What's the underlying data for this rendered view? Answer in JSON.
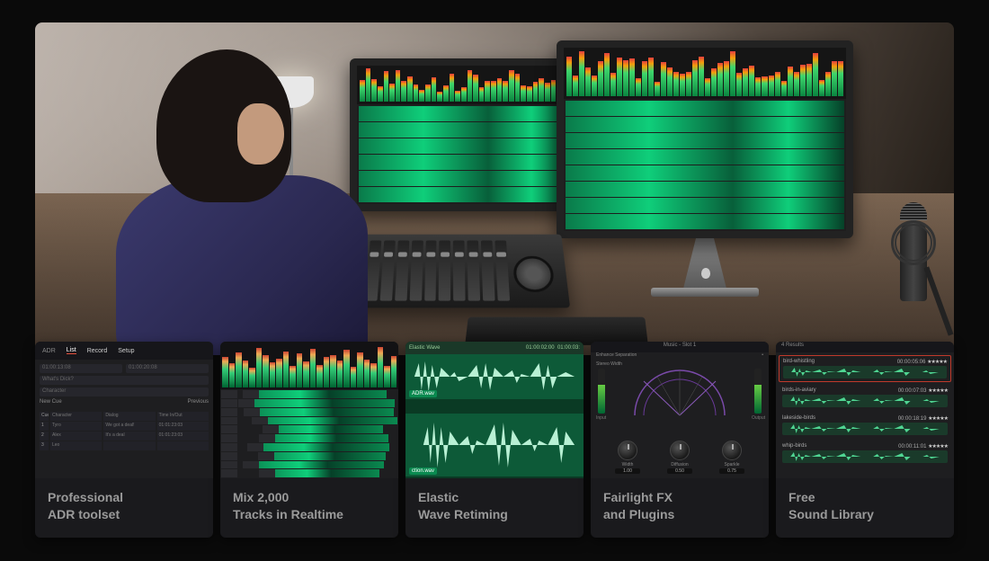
{
  "cards": [
    {
      "titleLine1": "Professional",
      "titleLine2": "ADR toolset"
    },
    {
      "titleLine1": "Mix 2,000",
      "titleLine2": "Tracks in Realtime"
    },
    {
      "titleLine1": "Elastic",
      "titleLine2": "Wave Retiming"
    },
    {
      "titleLine1": "Fairlight FX",
      "titleLine2": "and Plugins"
    },
    {
      "titleLine1": "Free",
      "titleLine2": "Sound Library"
    }
  ],
  "adr": {
    "panelTitle": "ADR",
    "tabs": [
      "List",
      "Record",
      "Setup"
    ],
    "tcIn": "01:00:13:08",
    "tcOut": "01:00:20:08",
    "dialogLabel": "What's Dick?",
    "characterLabel": "Character",
    "newCue": "New Cue",
    "prev": "Previous",
    "tableHeaders": [
      "Cue",
      "Character",
      "Dialog",
      "Time In/Out"
    ],
    "rows": [
      {
        "n": "1",
        "ch": "Tyro",
        "dlg": "We got a deal!",
        "tc": "01:01:23:03"
      },
      {
        "n": "2",
        "ch": "Alex",
        "dlg": "It's a deal",
        "tc": "01:01:23:03"
      },
      {
        "n": "3",
        "ch": "Leo",
        "dlg": "",
        "tc": ""
      }
    ]
  },
  "elastic": {
    "label": "Elastic Wave",
    "tc1": "01:00:02:00",
    "tc2": "01:00:03:",
    "file1": "ADR.wav",
    "file2": "ction.wav"
  },
  "fx": {
    "title": "Music - Slot 1",
    "sub1": "Enhance Separation",
    "sub2": "Stereo Width",
    "input": "Input",
    "output": "Output",
    "knobs": [
      {
        "label": "Width",
        "value": "1.00"
      },
      {
        "label": "Diffusion",
        "value": "0.50"
      },
      {
        "label": "Sparkle",
        "value": "0.75"
      }
    ]
  },
  "soundlib": {
    "header": "4 Results",
    "items": [
      {
        "name": "bird-whistling",
        "dur": "00:00:05:06",
        "selected": true
      },
      {
        "name": "birds-in-aviary",
        "dur": "00:00:07:03",
        "selected": false
      },
      {
        "name": "lakeside-birds",
        "dur": "00:00:18:19",
        "selected": false
      },
      {
        "name": "whip-birds",
        "dur": "00:00:11:01",
        "selected": false
      }
    ]
  },
  "mix": {
    "meterHeights": [
      70,
      55,
      80,
      62,
      45,
      90,
      73,
      58,
      66,
      82,
      49,
      77,
      60,
      88,
      52,
      69,
      74,
      61,
      85,
      47,
      79,
      63,
      56,
      91,
      50,
      72
    ],
    "trackCount": 10
  }
}
